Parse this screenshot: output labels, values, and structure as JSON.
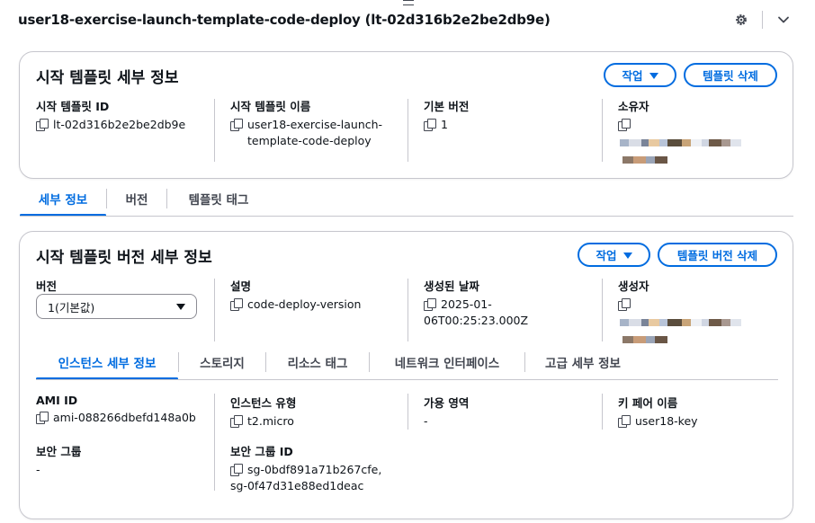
{
  "page": {
    "title": "user18-exercise-launch-template-code-deploy (lt-02d316b2e2be2db9e)"
  },
  "icons": {
    "settings": "gear-icon",
    "collapse": "chevron-down-icon",
    "copy": "copy-icon",
    "dropdown": "caret-down-icon"
  },
  "colors": {
    "accent": "#006ce0",
    "border": "#c6c6cd",
    "text": "#0f141a"
  },
  "details_card": {
    "title": "시작 템플릿 세부 정보",
    "actions_label": "작업",
    "delete_label": "템플릿 삭제",
    "fields": {
      "id_label": "시작 템플릿 ID",
      "id_value": "lt-02d316b2e2be2db9e",
      "name_label": "시작 템플릿 이름",
      "name_value": "user18-exercise-launch-template-code-deploy",
      "default_version_label": "기본 버전",
      "default_version_value": "1",
      "owner_label": "소유자"
    }
  },
  "main_tabs": [
    "세부 정보",
    "버전",
    "템플릿 태그"
  ],
  "version_card": {
    "title": "시작 템플릿 버전 세부 정보",
    "actions_label": "작업",
    "delete_label": "템플릿 버전 삭제",
    "version_label": "버전",
    "version_selected": "1(기본값)",
    "description_label": "설명",
    "description_value": "code-deploy-version",
    "created_label": "생성된 날짜",
    "created_value": "2025-01-06T00:25:23.000Z",
    "creator_label": "생성자"
  },
  "inner_tabs": [
    "인스턴스 세부 정보",
    "스토리지",
    "리소스 태그",
    "네트워크 인터페이스",
    "고급 세부 정보"
  ],
  "instance_details": {
    "ami_label": "AMI ID",
    "ami_value": "ami-088266dbefd148a0b",
    "type_label": "인스턴스 유형",
    "type_value": "t2.micro",
    "az_label": "가용 영역",
    "az_value": "-",
    "keypair_label": "키 페어 이름",
    "keypair_value": "user18-key",
    "sg_label": "보안 그룹",
    "sg_value": "-",
    "sgid_label": "보안 그룹 ID",
    "sgid_value_1": "sg-0bdf891a71b267cfe,",
    "sgid_value_2": "sg-0f47d31e88ed1deac"
  }
}
